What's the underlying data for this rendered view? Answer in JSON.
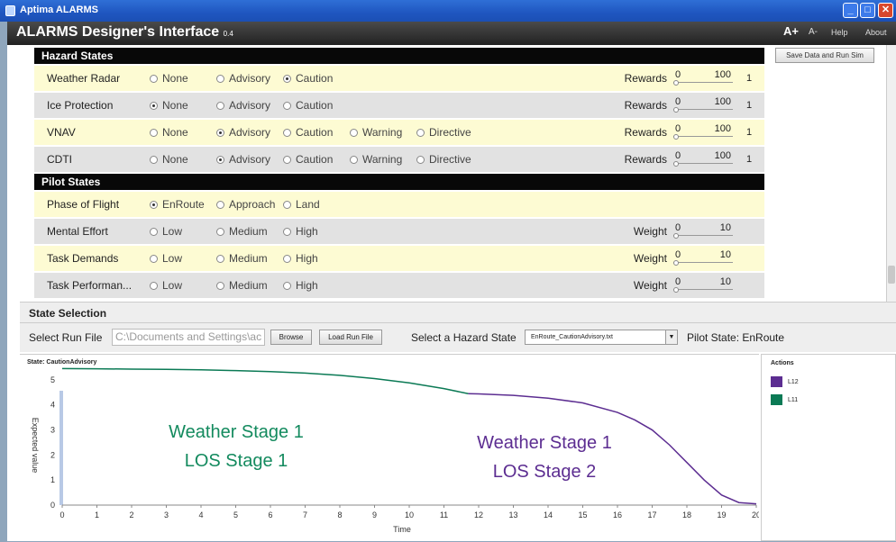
{
  "window": {
    "title": "Aptima ALARMS",
    "min": "_",
    "max": "□",
    "close": "✕"
  },
  "header": {
    "title": "ALARMS Designer's Interface",
    "version": "0.4",
    "font_plus": "A+",
    "font_minus": "A-",
    "help": "Help",
    "about": "About"
  },
  "save_button": "Save Data and Run Sim",
  "hazard": {
    "header": "Hazard States",
    "rows": [
      {
        "label": "Weather Radar",
        "options": [
          "None",
          "Advisory",
          "Caution"
        ],
        "selected": 2,
        "reward_label": "Rewards",
        "min": "0",
        "max": "100",
        "value": "1"
      },
      {
        "label": "Ice Protection",
        "options": [
          "None",
          "Advisory",
          "Caution"
        ],
        "selected": 0,
        "reward_label": "Rewards",
        "min": "0",
        "max": "100",
        "value": "1"
      },
      {
        "label": "VNAV",
        "options": [
          "None",
          "Advisory",
          "Caution",
          "Warning",
          "Directive"
        ],
        "selected": 1,
        "reward_label": "Rewards",
        "min": "0",
        "max": "100",
        "value": "1"
      },
      {
        "label": "CDTI",
        "options": [
          "None",
          "Advisory",
          "Caution",
          "Warning",
          "Directive"
        ],
        "selected": 1,
        "reward_label": "Rewards",
        "min": "0",
        "max": "100",
        "value": "1"
      }
    ]
  },
  "pilot": {
    "header": "Pilot States",
    "rows": [
      {
        "label": "Phase of Flight",
        "options": [
          "EnRoute",
          "Approach",
          "Land"
        ],
        "selected": 0
      },
      {
        "label": "Mental Effort",
        "options": [
          "Low",
          "Medium",
          "High"
        ],
        "selected": -1,
        "weight_label": "Weight",
        "min": "0",
        "max": "10"
      },
      {
        "label": "Task Demands",
        "options": [
          "Low",
          "Medium",
          "High"
        ],
        "selected": -1,
        "weight_label": "Weight",
        "min": "0",
        "max": "10"
      },
      {
        "label": "Task Performan...",
        "options": [
          "Low",
          "Medium",
          "High"
        ],
        "selected": -1,
        "weight_label": "Weight",
        "min": "0",
        "max": "10"
      }
    ]
  },
  "state_selection": {
    "title": "State Selection",
    "run_file_label": "Select Run File",
    "run_file_value": "C:\\Documents and Settings\\ac",
    "browse": "Browse",
    "load": "Load Run File",
    "hazard_label": "Select a Hazard State",
    "hazard_value": "EnRoute_CautionAdvisory.txt",
    "pilot_state": "Pilot State: EnRoute"
  },
  "chart_title": "State: CautionAdvisory",
  "actions": {
    "title": "Actions",
    "items": [
      {
        "name": "L12",
        "color": "#5c2d91"
      },
      {
        "name": "L11",
        "color": "#0b7a55"
      }
    ]
  },
  "colors": {
    "teal": "#138a5e",
    "purple": "#5c2d91"
  },
  "chart_data": {
    "type": "line",
    "title": "",
    "xlabel": "Time",
    "ylabel": "Expected value",
    "xlim": [
      0,
      20
    ],
    "ylim": [
      0,
      5.5
    ],
    "xticks": [
      0,
      1,
      2,
      3,
      4,
      5,
      6,
      7,
      8,
      9,
      10,
      11,
      12,
      13,
      14,
      15,
      16,
      17,
      18,
      19,
      20
    ],
    "yticks": [
      0,
      1,
      2,
      3,
      4,
      5
    ],
    "series": [
      {
        "name": "L11",
        "color": "#0b7a55",
        "x": [
          0,
          1,
          2,
          3,
          4,
          5,
          6,
          7,
          8,
          9,
          10,
          11,
          11.7
        ],
        "y": [
          5.45,
          5.44,
          5.43,
          5.42,
          5.4,
          5.37,
          5.33,
          5.27,
          5.18,
          5.05,
          4.88,
          4.65,
          4.45
        ]
      },
      {
        "name": "L12",
        "color": "#5c2d91",
        "x": [
          11.7,
          12,
          13,
          14,
          15,
          16,
          16.5,
          17,
          17.5,
          18,
          18.5,
          19,
          19.5,
          20
        ],
        "y": [
          4.45,
          4.44,
          4.38,
          4.27,
          4.08,
          3.7,
          3.4,
          3.0,
          2.4,
          1.7,
          1.0,
          0.4,
          0.1,
          0.05
        ]
      }
    ],
    "annotations": [
      {
        "lines": [
          "Weather  Stage 1",
          "LOS Stage 1"
        ],
        "color": "#138a5e"
      },
      {
        "lines": [
          "Weather  Stage 1",
          "LOS Stage 2"
        ],
        "color": "#5c2d91"
      }
    ]
  }
}
